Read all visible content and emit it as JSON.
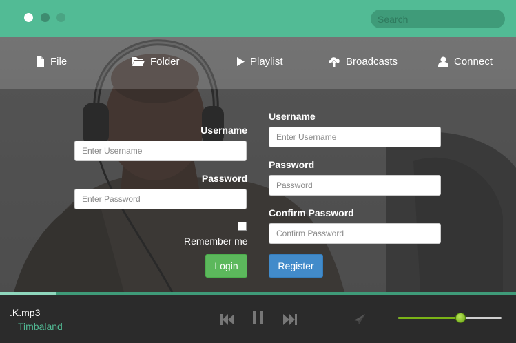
{
  "titlebar": {
    "search": {
      "placeholder": "Search"
    }
  },
  "nav": {
    "items": [
      {
        "label": "File",
        "icon": "file-icon"
      },
      {
        "label": "Folder",
        "icon": "folder-icon"
      },
      {
        "label": "Playlist",
        "icon": "play-icon"
      },
      {
        "label": "Broadcasts",
        "icon": "cloud-upload-icon"
      },
      {
        "label": "Connect",
        "icon": "user-icon"
      }
    ]
  },
  "login": {
    "username_label": "Username",
    "username_placeholder": "Enter Username",
    "password_label": "Password",
    "password_placeholder": "Enter Password",
    "remember_label": "Remember me",
    "remember_checked": false,
    "button": "Login"
  },
  "register": {
    "username_label": "Username",
    "username_placeholder": "Enter Username",
    "password_label": "Password",
    "password_placeholder": "Password",
    "confirm_label": "Confirm Password",
    "confirm_placeholder": "Confirm Password",
    "button": "Register"
  },
  "player": {
    "track": ".K.mp3",
    "artist": "Timbaland",
    "progress": 0.11,
    "volume": 0.6,
    "controls": [
      "previous-icon",
      "pause-icon",
      "next-icon",
      "send-icon"
    ]
  },
  "colors": {
    "accent": "#52bb95",
    "login_button": "#5cb85c",
    "register_button": "#428bca",
    "volume": "#7ab317"
  }
}
